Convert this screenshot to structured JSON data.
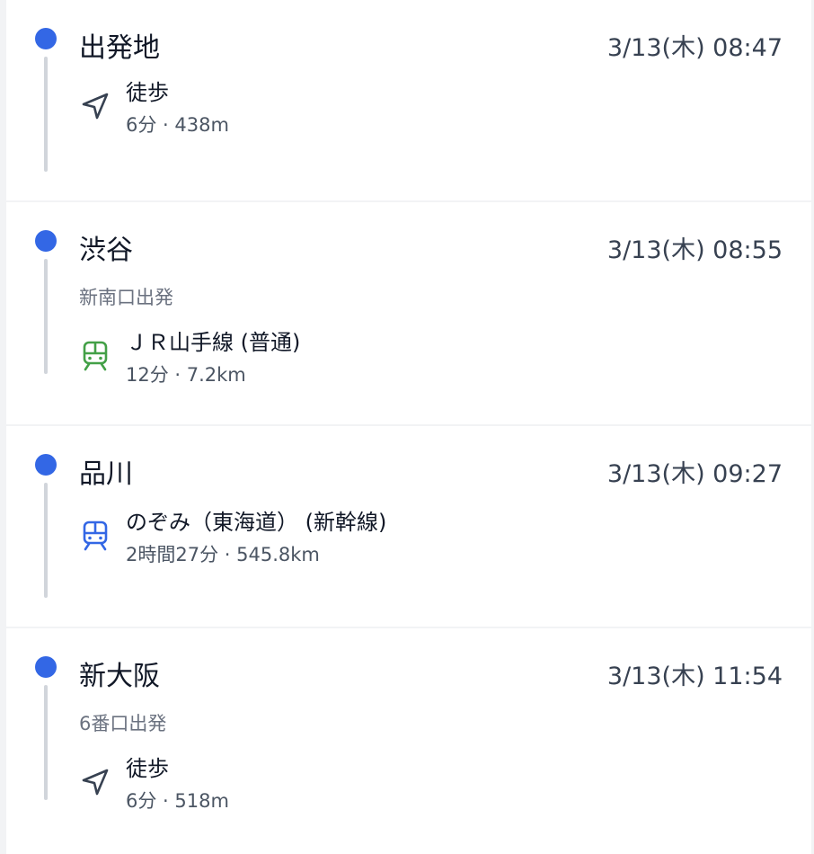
{
  "stops": [
    {
      "station": "出発地",
      "time": "3/13(木) 08:47",
      "leg": {
        "mode_icon": "navigation-arrow-icon",
        "name": "徒歩",
        "meta": "6分 · 438m"
      }
    },
    {
      "station": "渋谷",
      "time": "3/13(木) 08:55",
      "exit": "新南口出発",
      "leg": {
        "mode_icon": "train-icon",
        "color": "#43a047",
        "name": "ＪＲ山手線 (普通)",
        "meta": "12分 · 7.2km"
      }
    },
    {
      "station": "品川",
      "time": "3/13(木) 09:27",
      "leg": {
        "mode_icon": "train-icon",
        "color": "#3367e5",
        "name": "のぞみ（東海道） (新幹線)",
        "meta": "2時間27分 · 545.8km"
      }
    },
    {
      "station": "新大阪",
      "time": "3/13(木) 11:54",
      "exit": "6番口出発",
      "leg": {
        "mode_icon": "navigation-arrow-icon",
        "name": "徒歩",
        "meta": "6分 · 518m"
      }
    }
  ],
  "colors": {
    "dot": "#3367e5",
    "timeline": "#d1d5db",
    "card": "#ffffff",
    "background": "#f2f3f5"
  }
}
